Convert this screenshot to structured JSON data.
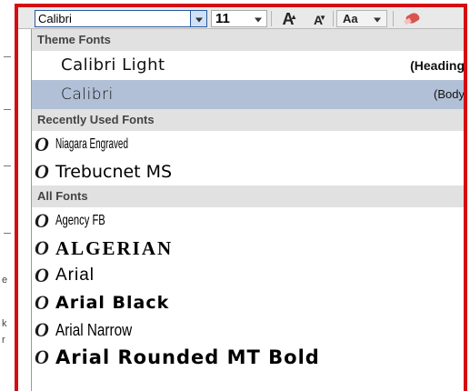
{
  "toolbar": {
    "font_name_value": "Calibri",
    "font_size_value": "11",
    "grow_font_label": "A",
    "shrink_font_label": "A",
    "change_case_label": "Aa",
    "accent_color": "#2b579a",
    "highlight_frame_color": "#d40d12"
  },
  "font_dropdown": {
    "sections": [
      {
        "header": "Theme Fonts",
        "items": [
          {
            "name": "Calibri Light",
            "role": "(Heading",
            "selected": false
          },
          {
            "name": "Calibri",
            "role": "(Body",
            "selected": true
          }
        ]
      },
      {
        "header": "Recently Used Fonts",
        "items": [
          {
            "name": "Niagara Engraved",
            "icon": "opentype-icon"
          },
          {
            "name": "Trebucnet MS",
            "icon": "opentype-icon"
          }
        ]
      },
      {
        "header": "All Fonts",
        "items": [
          {
            "name": "Agency FB",
            "icon": "opentype-icon"
          },
          {
            "name": "ALGERIAN",
            "icon": "opentype-icon"
          },
          {
            "name": "Arial",
            "icon": "opentype-icon"
          },
          {
            "name": "Arial Black",
            "icon": "opentype-icon"
          },
          {
            "name": "Arial Narrow",
            "icon": "opentype-icon"
          },
          {
            "name": "Arial Rounded MT Bold",
            "icon": "opentype-icon"
          }
        ]
      }
    ],
    "opentype_glyph": "O",
    "selected_color": "#b1c0d6"
  },
  "document_edge": {
    "marks": [
      "e",
      "k",
      "r"
    ]
  }
}
